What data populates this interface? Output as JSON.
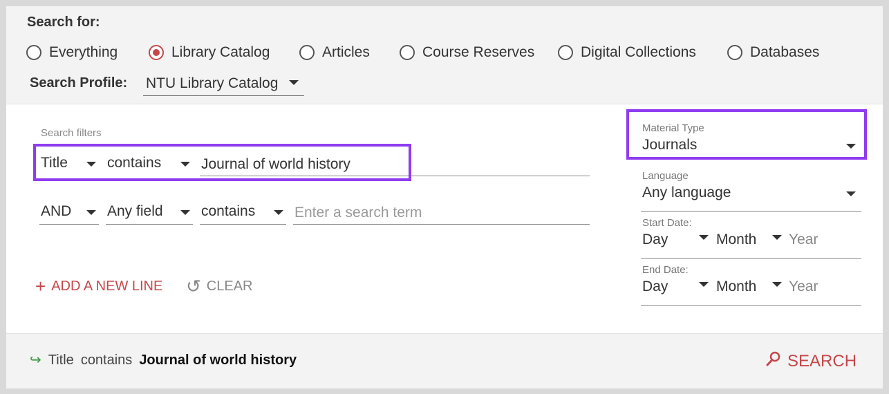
{
  "search_for": {
    "label": "Search for:",
    "options": [
      {
        "label": "Everything",
        "selected": false
      },
      {
        "label": "Library Catalog",
        "selected": true
      },
      {
        "label": "Articles",
        "selected": false
      },
      {
        "label": "Course Reserves",
        "selected": false
      },
      {
        "label": "Digital Collections",
        "selected": false
      },
      {
        "label": "Databases",
        "selected": false
      }
    ]
  },
  "search_profile": {
    "label": "Search Profile:",
    "value": "NTU Library Catalog"
  },
  "filters": {
    "label": "Search filters",
    "line1": {
      "field": "Title",
      "operator": "contains",
      "value": "Journal of world history"
    },
    "line2": {
      "boolean": "AND",
      "field": "Any field",
      "operator": "contains",
      "placeholder": "Enter a search term"
    }
  },
  "actions": {
    "add_line": "ADD A NEW LINE",
    "clear": "CLEAR"
  },
  "material_type": {
    "label": "Material Type",
    "value": "Journals"
  },
  "language": {
    "label": "Language",
    "value": "Any language"
  },
  "start_date": {
    "label": "Start Date:",
    "day": "Day",
    "month": "Month",
    "year": "Year"
  },
  "end_date": {
    "label": "End Date:",
    "day": "Day",
    "month": "Month",
    "year": "Year"
  },
  "query_preview": {
    "field": "Title",
    "operator": "contains",
    "term": "Journal of world history"
  },
  "search_button": {
    "label": "SEARCH"
  },
  "colors": {
    "accent": "#c4474a",
    "highlight": "#8f3cf0",
    "green_arrow": "#3a9a3a"
  }
}
